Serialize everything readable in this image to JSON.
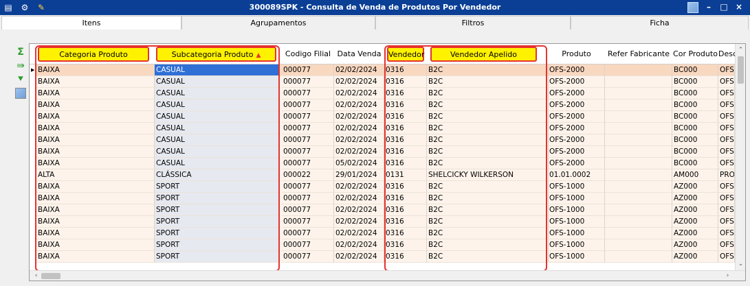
{
  "window": {
    "title": "300089SPK - Consulta de Venda de Produtos Por Vendedor",
    "buttons": {
      "minimize": "–",
      "maximize": "□",
      "close": "×"
    }
  },
  "tabs": [
    {
      "label": "Itens",
      "active": true
    },
    {
      "label": "Agrupamentos",
      "active": false
    },
    {
      "label": "Filtros",
      "active": false
    },
    {
      "label": "Ficha",
      "active": false
    }
  ],
  "side_toolbar": [
    "sum-icon",
    "export-icon",
    "filter-down-icon",
    "user-photo-icon"
  ],
  "grid": {
    "columns": {
      "categoria": "Categoria Produto",
      "subcategoria": "Subcategoria Produto",
      "codigo_filial": "Codigo Filial",
      "data_venda": "Data Venda",
      "vendedor": "Vendedor",
      "vendedor_apelido": "Vendedor Apelido",
      "produto": "Produto",
      "refer_fabricante": "Refer Fabricante",
      "cor_produto": "Cor Produto",
      "desc": "Desc"
    },
    "sort": {
      "column": "Subcategoria Produto",
      "direction": "ascending"
    },
    "rows": [
      {
        "cat": "BAIXA",
        "sub": "CASUAL",
        "fil": "000077",
        "data": "02/02/2024",
        "vend": "0316",
        "apel": "B2C",
        "prod": "OFS-2000",
        "ref": "",
        "cor": "BC000",
        "desc": "OFS"
      },
      {
        "cat": "BAIXA",
        "sub": "CASUAL",
        "fil": "000077",
        "data": "02/02/2024",
        "vend": "0316",
        "apel": "B2C",
        "prod": "OFS-2000",
        "ref": "",
        "cor": "BC000",
        "desc": "OFS"
      },
      {
        "cat": "BAIXA",
        "sub": "CASUAL",
        "fil": "000077",
        "data": "02/02/2024",
        "vend": "0316",
        "apel": "B2C",
        "prod": "OFS-2000",
        "ref": "",
        "cor": "BC000",
        "desc": "OFS"
      },
      {
        "cat": "BAIXA",
        "sub": "CASUAL",
        "fil": "000077",
        "data": "02/02/2024",
        "vend": "0316",
        "apel": "B2C",
        "prod": "OFS-2000",
        "ref": "",
        "cor": "BC000",
        "desc": "OFS"
      },
      {
        "cat": "BAIXA",
        "sub": "CASUAL",
        "fil": "000077",
        "data": "02/02/2024",
        "vend": "0316",
        "apel": "B2C",
        "prod": "OFS-2000",
        "ref": "",
        "cor": "BC000",
        "desc": "OFS"
      },
      {
        "cat": "BAIXA",
        "sub": "CASUAL",
        "fil": "000077",
        "data": "02/02/2024",
        "vend": "0316",
        "apel": "B2C",
        "prod": "OFS-2000",
        "ref": "",
        "cor": "BC000",
        "desc": "OFS"
      },
      {
        "cat": "BAIXA",
        "sub": "CASUAL",
        "fil": "000077",
        "data": "02/02/2024",
        "vend": "0316",
        "apel": "B2C",
        "prod": "OFS-2000",
        "ref": "",
        "cor": "BC000",
        "desc": "OFS"
      },
      {
        "cat": "BAIXA",
        "sub": "CASUAL",
        "fil": "000077",
        "data": "02/02/2024",
        "vend": "0316",
        "apel": "B2C",
        "prod": "OFS-2000",
        "ref": "",
        "cor": "BC000",
        "desc": "OFS"
      },
      {
        "cat": "BAIXA",
        "sub": "CASUAL",
        "fil": "000077",
        "data": "05/02/2024",
        "vend": "0316",
        "apel": "B2C",
        "prod": "OFS-2000",
        "ref": "",
        "cor": "BC000",
        "desc": "OFS"
      },
      {
        "cat": "ALTA",
        "sub": "CLÁSSICA",
        "fil": "000022",
        "data": "29/01/2024",
        "vend": "0131",
        "apel": "SHELCICKY WILKERSON",
        "prod": "01.01.0002",
        "ref": "",
        "cor": "AM000",
        "desc": "PRO"
      },
      {
        "cat": "BAIXA",
        "sub": "SPORT",
        "fil": "000077",
        "data": "02/02/2024",
        "vend": "0316",
        "apel": "B2C",
        "prod": "OFS-1000",
        "ref": "",
        "cor": "AZ000",
        "desc": "OFS"
      },
      {
        "cat": "BAIXA",
        "sub": "SPORT",
        "fil": "000077",
        "data": "02/02/2024",
        "vend": "0316",
        "apel": "B2C",
        "prod": "OFS-1000",
        "ref": "",
        "cor": "AZ000",
        "desc": "OFS"
      },
      {
        "cat": "BAIXA",
        "sub": "SPORT",
        "fil": "000077",
        "data": "02/02/2024",
        "vend": "0316",
        "apel": "B2C",
        "prod": "OFS-1000",
        "ref": "",
        "cor": "AZ000",
        "desc": "OFS"
      },
      {
        "cat": "BAIXA",
        "sub": "SPORT",
        "fil": "000077",
        "data": "02/02/2024",
        "vend": "0316",
        "apel": "B2C",
        "prod": "OFS-1000",
        "ref": "",
        "cor": "AZ000",
        "desc": "OFS"
      },
      {
        "cat": "BAIXA",
        "sub": "SPORT",
        "fil": "000077",
        "data": "02/02/2024",
        "vend": "0316",
        "apel": "B2C",
        "prod": "OFS-1000",
        "ref": "",
        "cor": "AZ000",
        "desc": "OFS"
      },
      {
        "cat": "BAIXA",
        "sub": "SPORT",
        "fil": "000077",
        "data": "02/02/2024",
        "vend": "0316",
        "apel": "B2C",
        "prod": "OFS-1000",
        "ref": "",
        "cor": "AZ000",
        "desc": "OFS"
      },
      {
        "cat": "BAIXA",
        "sub": "SPORT",
        "fil": "000077",
        "data": "02/02/2024",
        "vend": "0316",
        "apel": "B2C",
        "prod": "OFS-1000",
        "ref": "",
        "cor": "AZ000",
        "desc": "OFS"
      }
    ]
  },
  "colors": {
    "titlebar": "#0b3f96",
    "highlight_header": "#fff200",
    "highlight_border": "#e6322e",
    "row_bg": "#fdf3ea",
    "selected_row_bg": "#f9d8c0"
  }
}
